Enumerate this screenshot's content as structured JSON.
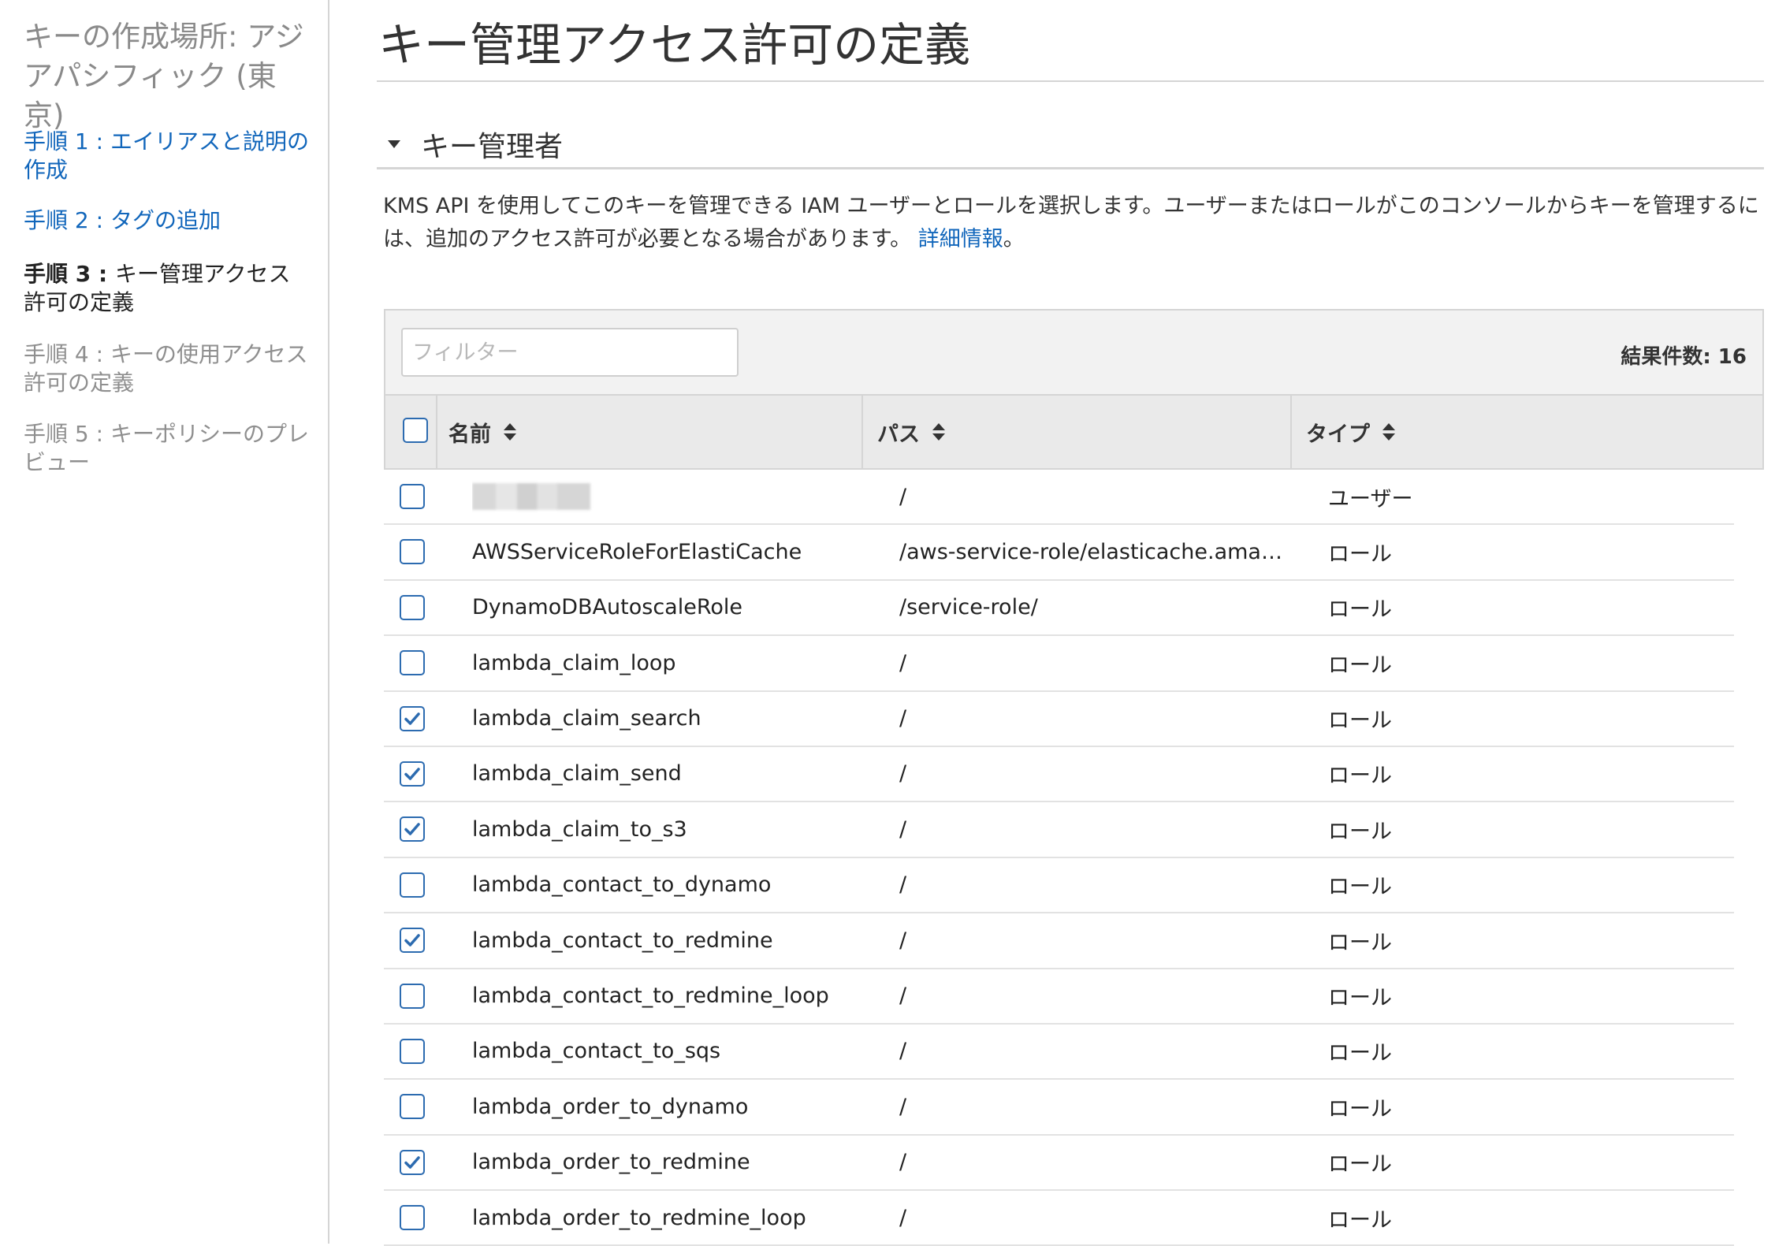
{
  "sidebar": {
    "title": "キーの作成場所: アジアパシフィック (東京)",
    "steps": [
      {
        "prefix": "手順 1 : ",
        "label": "エイリアスと説明の作成",
        "state": "done"
      },
      {
        "prefix": "手順 2 : ",
        "label": "タグの追加",
        "state": "done"
      },
      {
        "prefix": "手順 3 : ",
        "label": "キー管理アクセス許可の定義",
        "state": "current"
      },
      {
        "prefix": "手順 4 : ",
        "label": "キーの使用アクセス許可の定義",
        "state": "future"
      },
      {
        "prefix": "手順 5 : ",
        "label": "キーポリシーのプレビュー",
        "state": "future"
      }
    ]
  },
  "main": {
    "title": "キー管理アクセス許可の定義",
    "section_title": "キー管理者",
    "description": "KMS API を使用してこのキーを管理できる IAM ユーザーとロールを選択します。ユーザーまたはロールがこのコンソールからキーを管理するには、追加のアクセス許可が必要となる場合があります。",
    "description_link": "詳細情報",
    "description_end": "。"
  },
  "table": {
    "filter_placeholder": "フィルター",
    "filter_value": "",
    "result_count": "結果件数: 16",
    "columns": {
      "name": "名前",
      "path": "パス",
      "type": "タイプ"
    },
    "rows": [
      {
        "name": "",
        "redacted": true,
        "path": "/",
        "type": "ユーザー",
        "checked": false
      },
      {
        "name": "AWSServiceRoleForElastiCache",
        "path": "/aws-service-role/elasticache.amazonaws.com/",
        "type": "ロール",
        "checked": false
      },
      {
        "name": "DynamoDBAutoscaleRole",
        "path": "/service-role/",
        "type": "ロール",
        "checked": false
      },
      {
        "name": "lambda_claim_loop",
        "path": "/",
        "type": "ロール",
        "checked": false
      },
      {
        "name": "lambda_claim_search",
        "path": "/",
        "type": "ロール",
        "checked": true
      },
      {
        "name": "lambda_claim_send",
        "path": "/",
        "type": "ロール",
        "checked": true
      },
      {
        "name": "lambda_claim_to_s3",
        "path": "/",
        "type": "ロール",
        "checked": true
      },
      {
        "name": "lambda_contact_to_dynamo",
        "path": "/",
        "type": "ロール",
        "checked": false
      },
      {
        "name": "lambda_contact_to_redmine",
        "path": "/",
        "type": "ロール",
        "checked": true
      },
      {
        "name": "lambda_contact_to_redmine_loop",
        "path": "/",
        "type": "ロール",
        "checked": false
      },
      {
        "name": "lambda_contact_to_sqs",
        "path": "/",
        "type": "ロール",
        "checked": false
      },
      {
        "name": "lambda_order_to_dynamo",
        "path": "/",
        "type": "ロール",
        "checked": false
      },
      {
        "name": "lambda_order_to_redmine",
        "path": "/",
        "type": "ロール",
        "checked": true
      },
      {
        "name": "lambda_order_to_redmine_loop",
        "path": "/",
        "type": "ロール",
        "checked": false
      }
    ]
  },
  "colors": {
    "link": "#1166bb",
    "checkbox_border": "#2c6bb0",
    "header_bg": "#eaeaea",
    "toolbar_bg": "#f2f2f2"
  }
}
